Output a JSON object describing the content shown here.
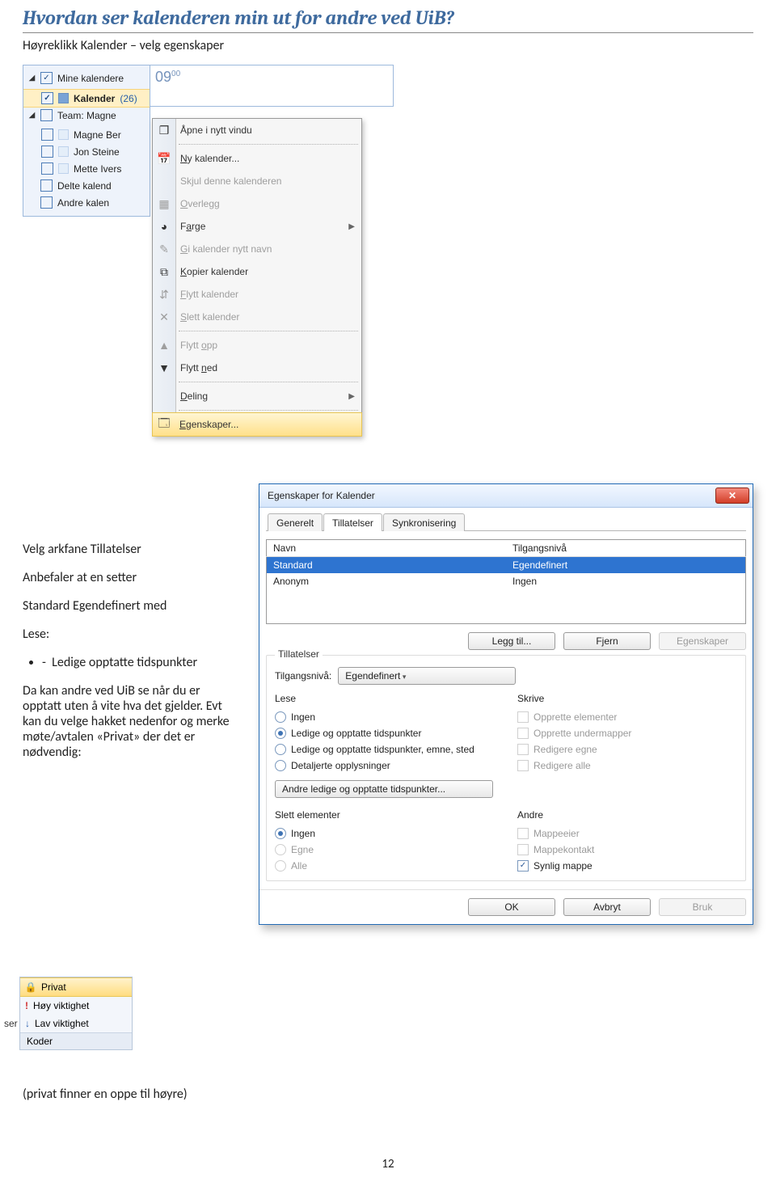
{
  "doc": {
    "title": "Hvordan ser kalenderen min ut for andre ved UiB?",
    "intro": "Høyreklikk Kalender – velg egenskaper",
    "help_block1": "Velg arkfane Tillatelser",
    "help_block2": "Anbefaler at en setter",
    "help_block3": "Standard Egendefinert med",
    "help_block4": "Lese:",
    "help_bullet": "Ledige opptatte tidspunkter",
    "help_block5": "Da kan andre ved UiB se når du er opptatt uten å vite hva det gjelder. Evt kan du velge hakket nedenfor og merke møte/avtalen «Privat» der det er nødvendig:",
    "help_block6": "(privat finner en oppe til høyre)",
    "pagenum": "12"
  },
  "sidebar": {
    "group": "Mine kalendere",
    "kalender": "Kalender",
    "kalender_count": "(26)",
    "items": [
      "Team: Magne",
      "Magne Ber",
      "Jon Steine",
      "Mette Ivers",
      "Delte kalend",
      "Andre kalen"
    ]
  },
  "time_hour": "09",
  "time_minute": "00",
  "context": {
    "open": "Åpne i nytt vindu",
    "new_cal": "Ny kalender...",
    "hide": "Skjul denne kalenderen",
    "overlay": "Overlegg",
    "color": "Farge",
    "rename": "Gi kalender nytt navn",
    "copy": "Kopier kalender",
    "move": "Flytt kalender",
    "delete": "Slett kalender",
    "move_up": "Flytt opp",
    "move_down": "Flytt ned",
    "sharing": "Deling",
    "props": "Egenskaper..."
  },
  "dialog": {
    "title": "Egenskaper for Kalender",
    "tabs": {
      "general": "Generelt",
      "perms": "Tillatelser",
      "sync": "Synkronisering"
    },
    "table": {
      "col_name": "Navn",
      "col_level": "Tilgangsnivå",
      "rows": [
        {
          "name": "Standard",
          "level": "Egendefinert"
        },
        {
          "name": "Anonym",
          "level": "Ingen"
        }
      ]
    },
    "add": "Legg til...",
    "remove": "Fjern",
    "props": "Egenskaper",
    "groupbox": "Tillatelser",
    "level_label": "Tilgangsnivå:",
    "level_value": "Egendefinert",
    "read": {
      "title": "Lese",
      "none": "Ingen",
      "freebusy": "Ledige og opptatte tidspunkter",
      "freebusy_extra": "Ledige og opptatte tidspunkter, emne, sted",
      "details": "Detaljerte opplysninger",
      "other": "Andre ledige og opptatte tidspunkter..."
    },
    "write": {
      "title": "Skrive",
      "create_items": "Opprette elementer",
      "create_subs": "Opprette undermapper",
      "edit_own": "Redigere egne",
      "edit_all": "Redigere alle"
    },
    "delete": {
      "title": "Slett elementer",
      "none": "Ingen",
      "own": "Egne",
      "all": "Alle"
    },
    "other": {
      "title": "Andre",
      "owner": "Mappeeier",
      "contact": "Mappekontakt",
      "visible": "Synlig mappe"
    },
    "ok": "OK",
    "cancel": "Avbryt",
    "apply": "Bruk"
  },
  "privat": {
    "privat": "Privat",
    "high": "Høy viktighet",
    "low": "Lav viktighet",
    "ser": "ser",
    "koder": "Koder"
  }
}
